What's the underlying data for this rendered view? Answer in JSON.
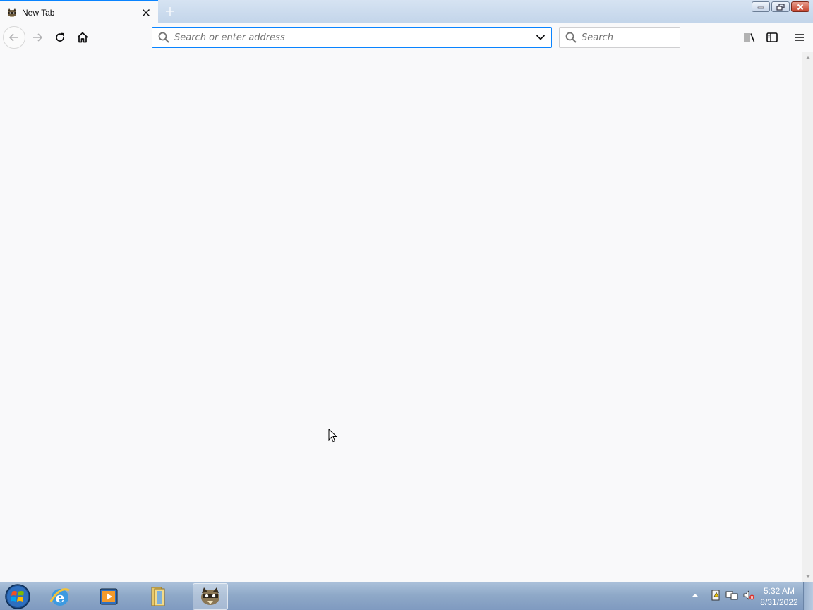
{
  "tab": {
    "title": "New Tab",
    "favicon": "raccoon-icon"
  },
  "navbar": {
    "url_placeholder": "Search or enter address",
    "search_placeholder": "Search"
  },
  "taskbar": {
    "items": [
      "start-orb",
      "internet-explorer-icon",
      "media-player-icon",
      "file-explorer-icon",
      "firefox-raccoon-icon"
    ],
    "tray_icons": [
      "show-hidden-icons-arrow",
      "action-center-icon",
      "network-icon",
      "volume-muted-icon"
    ],
    "time": "5:32 AM",
    "date": "8/31/2022"
  },
  "colors": {
    "accent": "#0a84ff",
    "toolbar_bg": "#f9f9fa",
    "titlebar_bg": "#c3d5ea",
    "taskbar_bg": "#8fa9c8"
  }
}
